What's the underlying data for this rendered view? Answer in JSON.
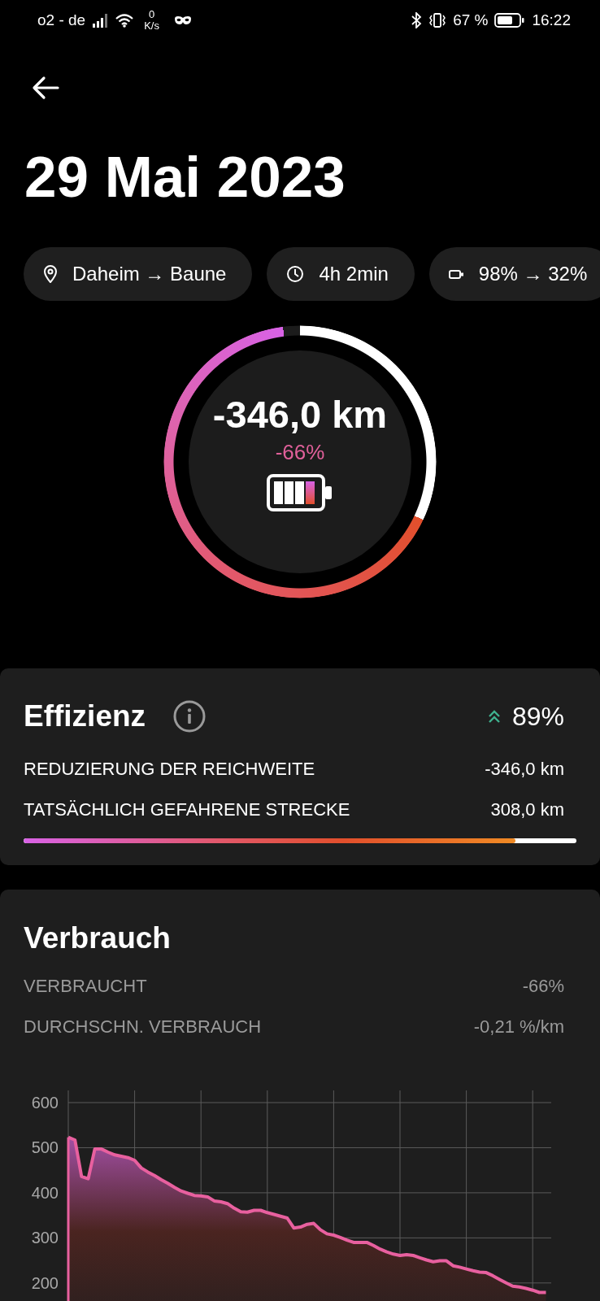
{
  "status_bar": {
    "carrier": "o2 - de",
    "speed_value": "0",
    "speed_unit": "K/s",
    "battery_percent": "67 %",
    "time": "16:22"
  },
  "title": "29 Mai 2023",
  "chips": [
    {
      "kind": "route",
      "label": "Daheim → Baune"
    },
    {
      "kind": "duration",
      "label": "4h 2min"
    },
    {
      "kind": "battery",
      "label": "98% → 32%"
    }
  ],
  "ring": {
    "value": "-346,0 km",
    "percent": "-66%"
  },
  "efficiency": {
    "title": "Effizienz",
    "score": "89%",
    "rows": [
      {
        "label": "REDUZIERUNG DER REICHWEITE",
        "value": "-346,0 km"
      },
      {
        "label": "TATSÄCHLICH GEFAHRENE STRECKE",
        "value": "308,0 km"
      }
    ],
    "bar": {
      "level": 0.89
    }
  },
  "consumption": {
    "title": "Verbrauch",
    "rows": [
      {
        "label": "VERBRAUCHT",
        "value": "-66%"
      },
      {
        "label": "DURCHSCHN. VERBRAUCH",
        "value": "-0,21 %/km"
      }
    ],
    "chart_data": {
      "type": "area",
      "grid": true,
      "ylim": [
        160,
        600
      ],
      "yticks": [
        200,
        300,
        400,
        500,
        600
      ],
      "categories": [
        null,
        null,
        null,
        null,
        null,
        null,
        null,
        null,
        null,
        null,
        null,
        null,
        null,
        null,
        null,
        null,
        null,
        null,
        null,
        null,
        null,
        null,
        null,
        null,
        null,
        null,
        null,
        null,
        null,
        null,
        null,
        null,
        null,
        null,
        null,
        null,
        null,
        null,
        null,
        null,
        null,
        null,
        null,
        null,
        null,
        null,
        null,
        null,
        null,
        null,
        null,
        null,
        null,
        null,
        null,
        null,
        null,
        null,
        null,
        null,
        null,
        null,
        null,
        null,
        null,
        null,
        null,
        null,
        null,
        null,
        null,
        null,
        null
      ],
      "series": [
        {
          "color": "#e8609f",
          "values": [
            523,
            517,
            436,
            431,
            497,
            497,
            490,
            484,
            481,
            478,
            472,
            455,
            446,
            438,
            429,
            421,
            412,
            404,
            399,
            394,
            393,
            391,
            382,
            380,
            376,
            366,
            358,
            357,
            361,
            361,
            356,
            352,
            348,
            344,
            322,
            324,
            330,
            332,
            318,
            309,
            306,
            301,
            295,
            290,
            290,
            290,
            283,
            275,
            269,
            264,
            261,
            263,
            261,
            256,
            251,
            247,
            249,
            249,
            238,
            235,
            231,
            227,
            224,
            223,
            216,
            208,
            200,
            193,
            191,
            188,
            184,
            179,
            179
          ]
        }
      ]
    }
  }
}
